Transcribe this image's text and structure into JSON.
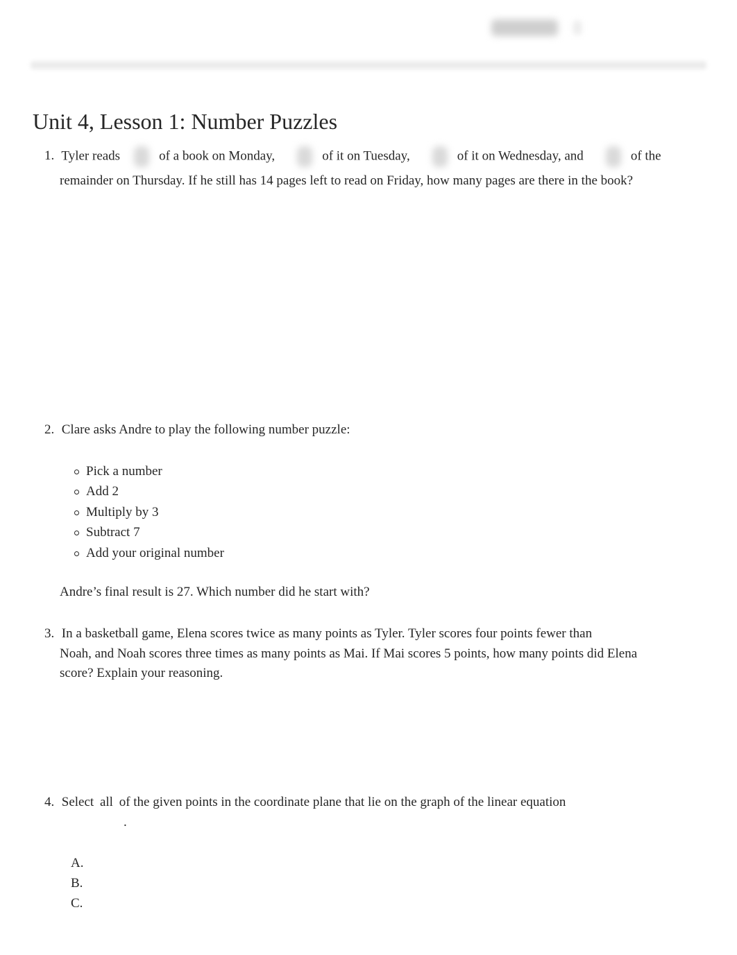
{
  "header": {
    "logo_icon": "blurred-logo"
  },
  "title": "Unit 4, Lesson 1: Number Puzzles",
  "questions": {
    "q1": {
      "number": "1.",
      "seg1": "Tyler reads",
      "seg2": "of a book on Monday,",
      "seg3": "of it on Tuesday,",
      "seg4": "of it on Wednesday, and",
      "seg5": "of the",
      "seg6": "remainder on Thursday. If he still has 14 pages left to read on Friday, how many pages are there in the book?"
    },
    "q2": {
      "number": "2.",
      "prompt": "Clare asks Andre to play the following number puzzle:",
      "steps": [
        "Pick a number",
        "Add 2",
        "Multiply by 3",
        "Subtract 7",
        "Add your original number"
      ],
      "final": "Andre’s final result is 27. Which number did he start with?"
    },
    "q3": {
      "number": "3.",
      "line1": "In a basketball game, Elena scores twice as many points as Tyler. Tyler scores four points fewer than",
      "rest": "Noah, and Noah scores three times as many points as Mai. If Mai scores 5 points, how many points did Elena score? Explain your reasoning."
    },
    "q4": {
      "number": "4.",
      "seg1": "Select",
      "emphasis": "all",
      "seg2": "of the given points in the coordinate plane that lie on the graph of the linear equation",
      "period": ".",
      "options": [
        "A.",
        "B.",
        "C."
      ]
    }
  }
}
